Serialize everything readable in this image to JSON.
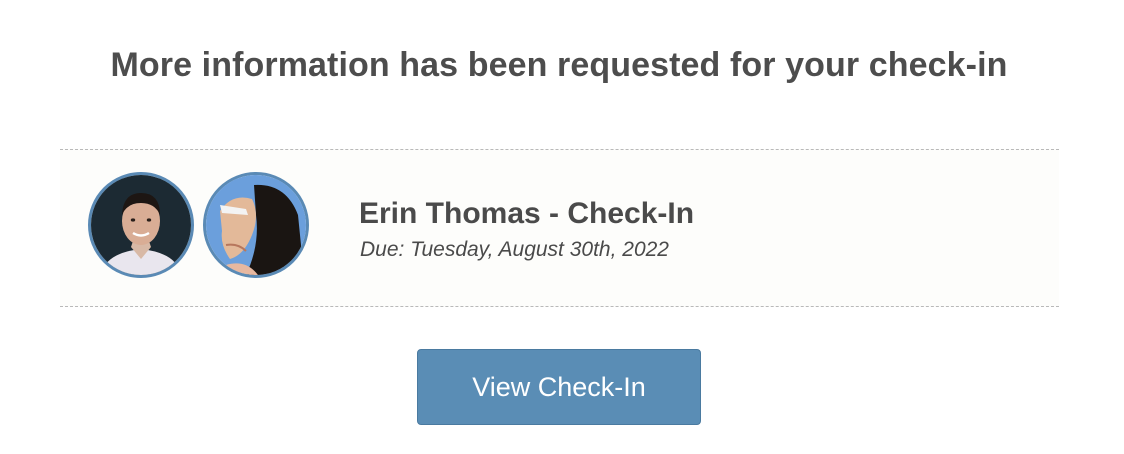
{
  "heading": "More information has been requested for your check-in",
  "checkin": {
    "title": "Erin Thomas - Check-In",
    "due": "Due: Tuesday, August 30th, 2022"
  },
  "avatars": [
    {
      "icon": "man-portrait-avatar"
    },
    {
      "icon": "woman-portrait-avatar"
    }
  ],
  "colors": {
    "accent": "#5a8db5",
    "avatar_ring": "#5a8ab5",
    "text": "#4a4a4a"
  },
  "cta": {
    "label": "View Check-In"
  }
}
